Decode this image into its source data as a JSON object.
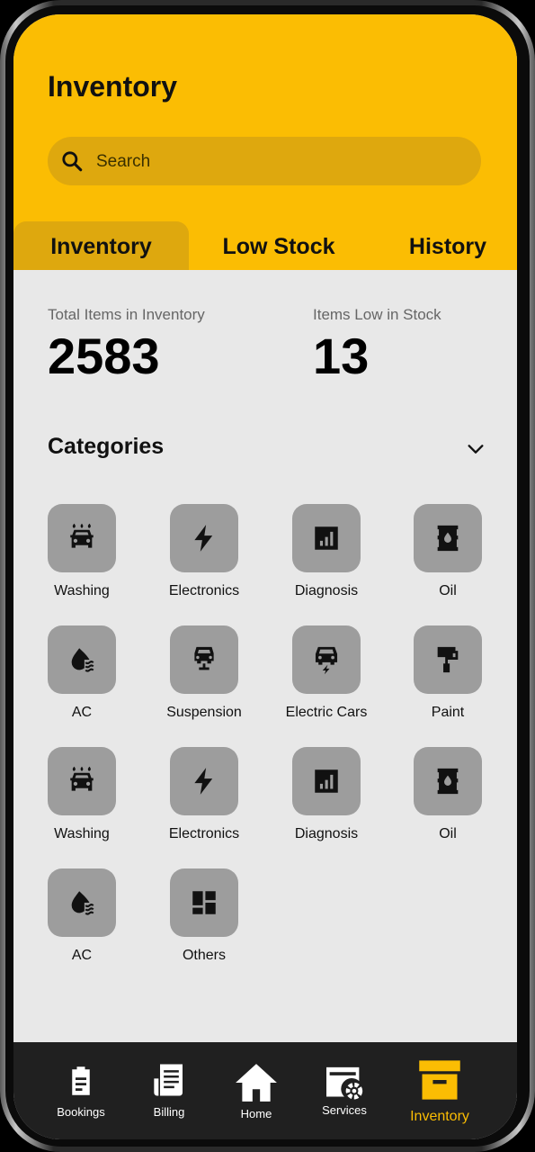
{
  "header": {
    "title": "Inventory",
    "search_placeholder": "Search"
  },
  "tabs": [
    {
      "label": "Inventory",
      "active": true
    },
    {
      "label": "Low Stock",
      "active": false
    },
    {
      "label": "History",
      "active": false
    }
  ],
  "stats": [
    {
      "label": "Total Items in Inventory",
      "value": "2583"
    },
    {
      "label": "Items Low in Stock",
      "value": "13"
    }
  ],
  "categories": {
    "title": "Categories",
    "items": [
      {
        "label": "Washing",
        "icon": "car-wash-icon"
      },
      {
        "label": "Electronics",
        "icon": "lightning-bolt-icon"
      },
      {
        "label": "Diagnosis",
        "icon": "bar-chart-icon"
      },
      {
        "label": "Oil",
        "icon": "oil-barrel-icon"
      },
      {
        "label": "AC",
        "icon": "ac-droplet-icon"
      },
      {
        "label": "Suspension",
        "icon": "car-suspension-icon"
      },
      {
        "label": "Electric Cars",
        "icon": "electric-car-icon"
      },
      {
        "label": "Paint",
        "icon": "paint-roller-icon"
      },
      {
        "label": "Washing",
        "icon": "car-wash-icon"
      },
      {
        "label": "Electronics",
        "icon": "lightning-bolt-icon"
      },
      {
        "label": "Diagnosis",
        "icon": "bar-chart-icon"
      },
      {
        "label": "Oil",
        "icon": "oil-barrel-icon"
      },
      {
        "label": "AC",
        "icon": "ac-droplet-icon"
      },
      {
        "label": "Others",
        "icon": "grid-icon"
      }
    ]
  },
  "bottom_nav": [
    {
      "label": "Bookings",
      "icon": "clipboard-icon",
      "active": false
    },
    {
      "label": "Billing",
      "icon": "receipt-icon",
      "active": false
    },
    {
      "label": "Home",
      "icon": "home-icon",
      "active": false
    },
    {
      "label": "Services",
      "icon": "services-gear-icon",
      "active": false
    },
    {
      "label": "Inventory",
      "icon": "archive-box-icon",
      "active": true
    }
  ],
  "colors": {
    "accent": "#fbbd03",
    "header_dark": "#dea80e",
    "tile": "#9d9d9d",
    "background": "#e8e8e8",
    "nav_background": "#202020"
  }
}
